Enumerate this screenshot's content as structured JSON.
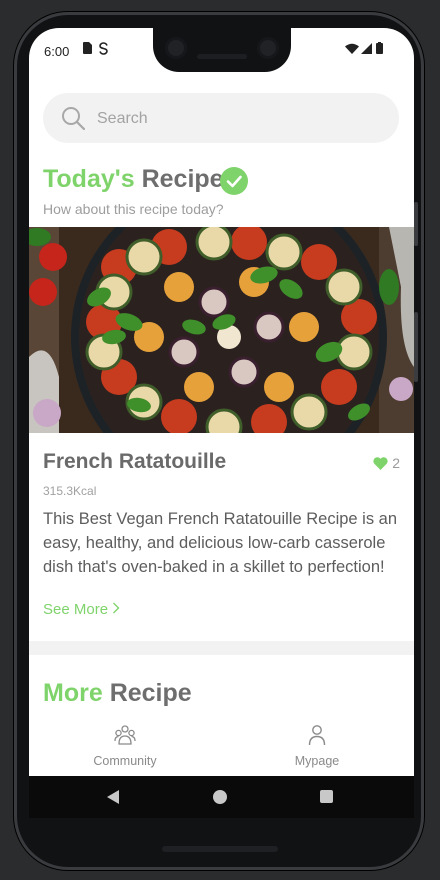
{
  "status_bar": {
    "time": "6:00"
  },
  "search": {
    "placeholder": "Search"
  },
  "section_today": {
    "title_highlight": "Today's",
    "title_rest": "Recipe",
    "subtitle": "How about this recipe today?"
  },
  "recipe": {
    "name": "French Ratatouille",
    "likes": "2",
    "calories": "315.3Kcal",
    "description": "This Best Vegan French Ratatouille Recipe is an easy, healthy, and delicious low-carb casserole dish that's oven-baked in a skillet to perfection!",
    "see_more": "See More"
  },
  "section_more": {
    "title_highlight": "More",
    "title_rest": "Recipe"
  },
  "tabs": [
    {
      "label": "Community",
      "icon": "community-icon"
    },
    {
      "label": "Mypage",
      "icon": "person-icon"
    }
  ],
  "colors": {
    "accent": "#7fd36b",
    "text_dark": "#6e6e6e"
  }
}
